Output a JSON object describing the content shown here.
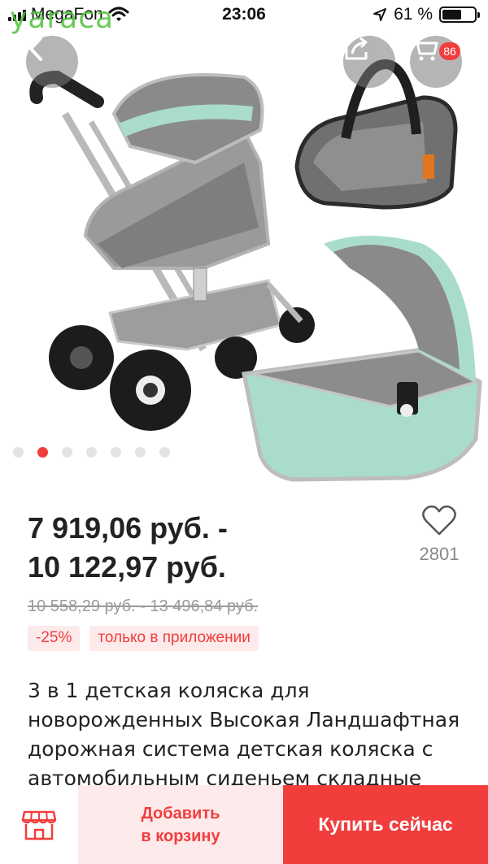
{
  "status_bar": {
    "carrier": "MegaFon",
    "time": "23:06",
    "battery_percent": "61 %",
    "battery_level": 0.61
  },
  "watermark": "yaraca",
  "gallery": {
    "cart_count": "86",
    "image_count": 7,
    "active_index": 1
  },
  "product": {
    "price_line1": "7 919,06 руб. -",
    "price_line2": "10 122,97 руб.",
    "old_price": "10 558,29 руб. - 13 496,84 руб.",
    "discount": "-25%",
    "app_only": "только в приложении",
    "favorites_count": "2801",
    "title": "3 в 1 детская коляска для новорожденных Высокая Ландшафтная дорожная система детская коляска с автомобильным сиденьем складные"
  },
  "actions": {
    "add_to_cart_line1": "Добавить",
    "add_to_cart_line2": "в корзину",
    "buy_now": "Купить сейчас"
  },
  "colors": {
    "accent": "#f23d3d",
    "accent_light": "#fdeaea",
    "mint": "#a9dccd",
    "fabric_gray": "#8c8c8c"
  }
}
